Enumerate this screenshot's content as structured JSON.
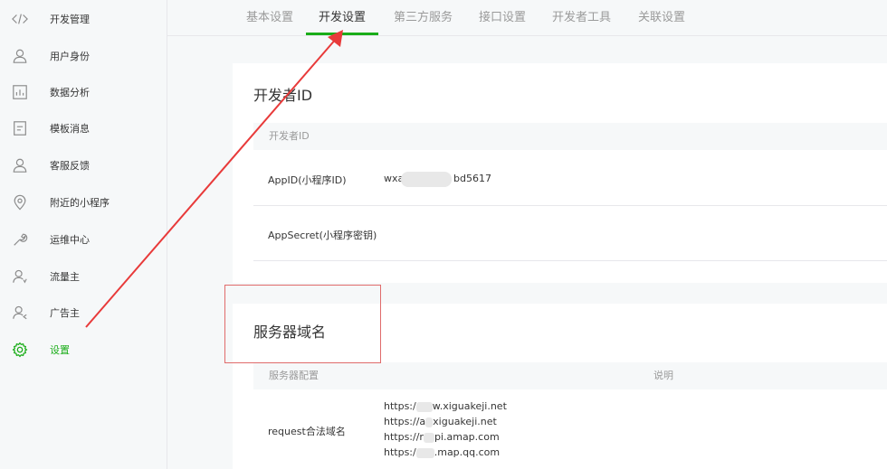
{
  "sidebar": {
    "items": [
      {
        "label": "开发管理",
        "icon": "code-icon"
      },
      {
        "label": "用户身份",
        "icon": "user-icon"
      },
      {
        "label": "数据分析",
        "icon": "chart-icon"
      },
      {
        "label": "模板消息",
        "icon": "document-icon"
      },
      {
        "label": "客服反馈",
        "icon": "user-icon"
      },
      {
        "label": "附近的小程序",
        "icon": "location-icon"
      },
      {
        "label": "运维中心",
        "icon": "wrench-icon"
      },
      {
        "label": "流量主",
        "icon": "user-flow-icon"
      },
      {
        "label": "广告主",
        "icon": "user-ad-icon"
      },
      {
        "label": "设置",
        "icon": "gear-icon"
      }
    ],
    "active_index": 9,
    "accent_color": "#1aad19"
  },
  "tabs": [
    {
      "label": "基本设置"
    },
    {
      "label": "开发设置"
    },
    {
      "label": "第三方服务"
    },
    {
      "label": "接口设置"
    },
    {
      "label": "开发者工具"
    },
    {
      "label": "关联设置"
    }
  ],
  "developer_id": {
    "title": "开发者ID",
    "table_header": "开发者ID",
    "appid_label": "AppID(小程序ID)",
    "appid_prefix": "wxa",
    "appid_suffix": "bd5617",
    "appsecret_label": "AppSecret(小程序密钥)"
  },
  "server_domain": {
    "title": "服务器域名",
    "col_config": "服务器配置",
    "col_desc": "说明",
    "request_label": "request合法域名",
    "domains": [
      {
        "prefix": "https:/",
        "suffix": "w.xiguakeji.net"
      },
      {
        "prefix": "https://a",
        "suffix": "xiguakeji.net"
      },
      {
        "prefix": "https://r",
        "suffix": "pi.amap.com"
      },
      {
        "prefix": "https:/",
        "suffix": ".map.qq.com"
      }
    ]
  },
  "annotation_color": "#e83a3a"
}
